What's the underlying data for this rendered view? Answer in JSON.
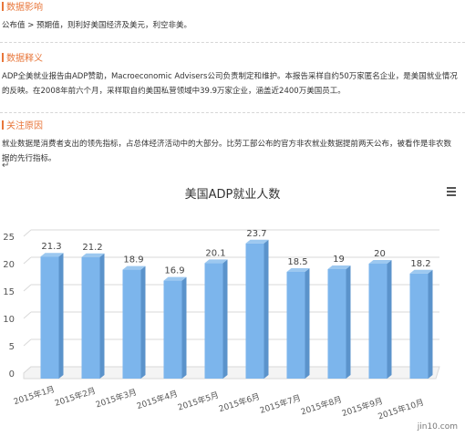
{
  "sections": [
    {
      "title": "数据影响",
      "body": "公布值 > 预期值，则利好美国经济及美元，利空非美。"
    },
    {
      "title": "数据释义",
      "body": "ADP全美就业报告由ADP赞助，Macroeconomic Advisers公司负责制定和维护。本报告采样自约50万家匿名企业，是美国就业情况的反映。在2008年前六个月，采样取自约美国私营领域中39.9万家企业，涵盖近2400万美国员工。"
    },
    {
      "title": "关注原因",
      "body": "就业数据是消费者支出的领先指标，占总体经济活动中的大部分。比劳工部公布的官方非农就业数据提前两天公布，被看作是非农数据的先行指标。"
    }
  ],
  "return_symbol": "↵",
  "watermark": "jin10.com",
  "chart_data": {
    "type": "bar",
    "title": "美国ADP就业人数",
    "categories": [
      "2015年1月",
      "2015年2月",
      "2015年3月",
      "2015年4月",
      "2015年5月",
      "2015年6月",
      "2015年7月",
      "2015年8月",
      "2015年9月",
      "2015年10月"
    ],
    "values": [
      21.3,
      21.2,
      18.9,
      16.9,
      20.1,
      23.7,
      18.5,
      19,
      20,
      18.2
    ],
    "value_labels": [
      "21.3",
      "21.2",
      "18.9",
      "16.9",
      "20.1",
      "23.7",
      "18.5",
      "19",
      "20",
      "18.2"
    ],
    "yticks": [
      "0",
      "5",
      "10",
      "15",
      "20",
      "25"
    ],
    "ylim": [
      0,
      25
    ],
    "xlabel": "",
    "ylabel": "",
    "grid": true,
    "bar_color": "#7cb5ec",
    "bar_side_color": "#5b93cb",
    "bar_top_color": "#9cc8f0"
  }
}
